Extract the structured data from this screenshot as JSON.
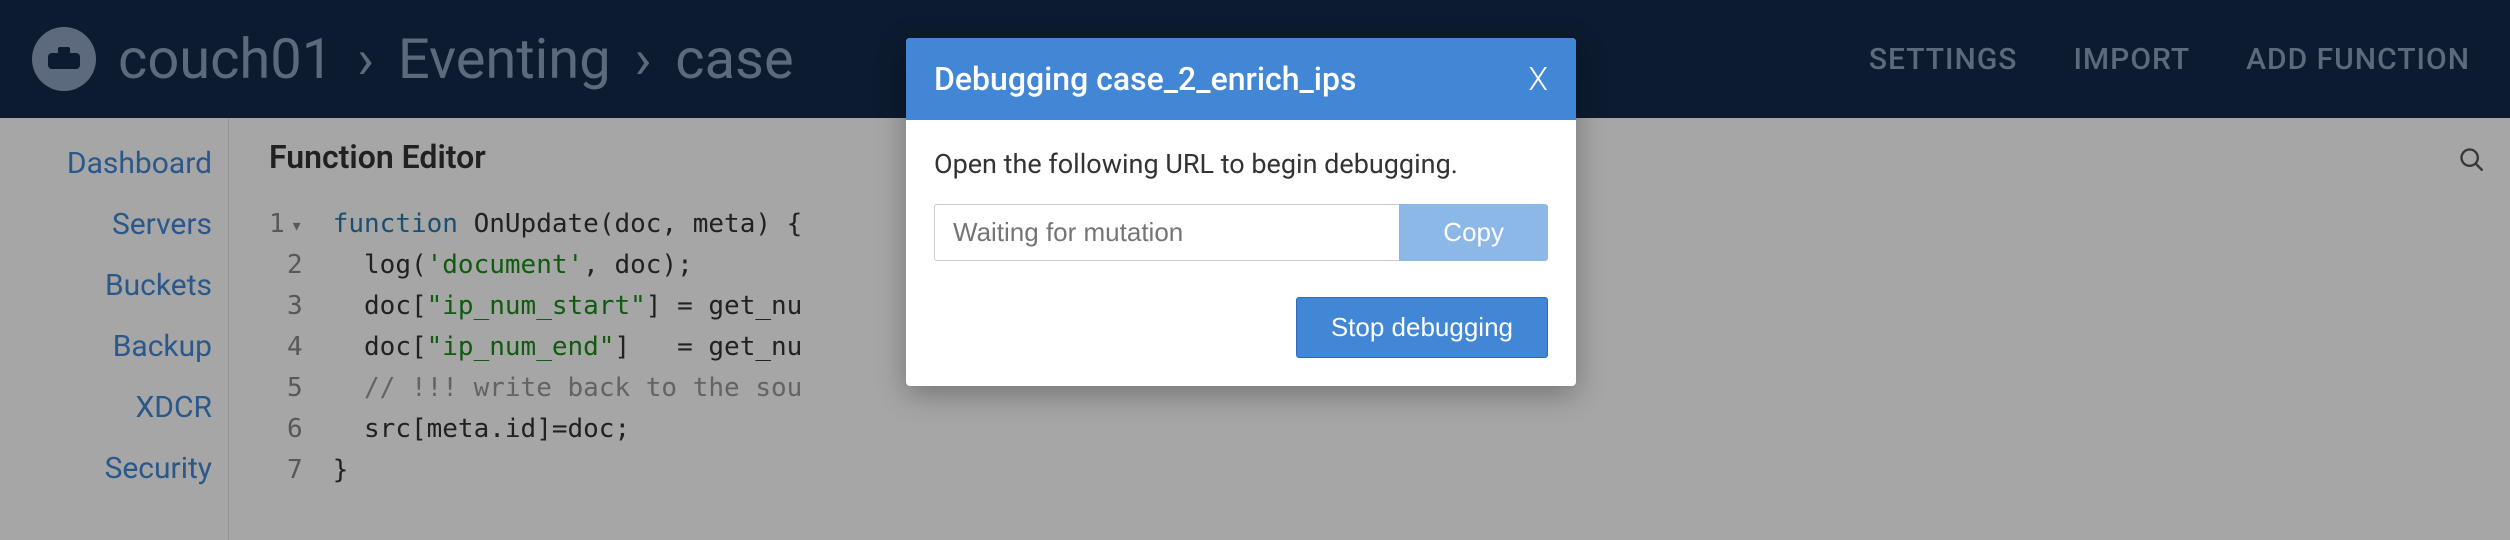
{
  "header": {
    "breadcrumb": {
      "cluster": "couch01",
      "section": "Eventing",
      "item_prefix": "case"
    },
    "actions": {
      "settings": "SETTINGS",
      "import": "IMPORT",
      "add_function": "ADD FUNCTION"
    }
  },
  "sidebar": {
    "items": [
      {
        "label": "Dashboard"
      },
      {
        "label": "Servers"
      },
      {
        "label": "Buckets"
      },
      {
        "label": "Backup"
      },
      {
        "label": "XDCR"
      },
      {
        "label": "Security"
      }
    ]
  },
  "editor": {
    "title": "Function Editor",
    "code_lines": [
      "function OnUpdate(doc, meta) {",
      "  log('document', doc);",
      "  doc[\"ip_num_start\"] = get_nu",
      "  doc[\"ip_num_end\"]   = get_nu",
      "  // !!! write back to the sou",
      "  src[meta.id]=doc;",
      "}"
    ]
  },
  "modal": {
    "title": "Debugging case_2_enrich_ips",
    "close_label": "X",
    "instruction": "Open the following URL to begin debugging.",
    "url_placeholder": "Waiting for mutation",
    "copy_label": "Copy",
    "stop_label": "Stop debugging"
  },
  "colors": {
    "header_bg": "#142a4a",
    "primary": "#4287d6"
  }
}
